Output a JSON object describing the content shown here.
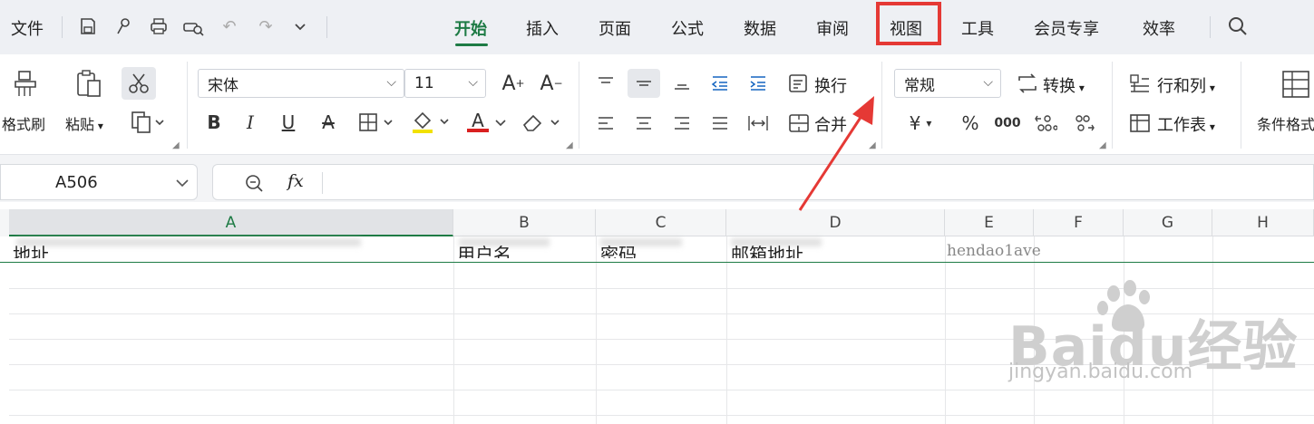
{
  "menu": {
    "file": "文件"
  },
  "tabs": [
    {
      "label": "开始",
      "active": true
    },
    {
      "label": "插入"
    },
    {
      "label": "页面"
    },
    {
      "label": "公式"
    },
    {
      "label": "数据"
    },
    {
      "label": "审阅"
    },
    {
      "label": "视图",
      "highlighted": true
    },
    {
      "label": "工具"
    },
    {
      "label": "会员专享"
    },
    {
      "label": "效率"
    }
  ],
  "ribbon": {
    "format_painter": "格式刷",
    "paste": "粘贴",
    "font_name": "宋体",
    "font_size": "11",
    "wrap_text": "换行",
    "merge": "合并",
    "number_format": "常规",
    "convert": "转换",
    "rows_cols": "行和列",
    "worksheet": "工作表",
    "conditional_format": "条件格式",
    "currency_symbol": "¥",
    "percent_symbol": "%",
    "thousands_symbol": "000",
    "bold": "B",
    "italic": "I",
    "underline": "U",
    "strike": "A",
    "font_color": "A"
  },
  "formula_bar": {
    "cell_ref": "A506",
    "fx": "fx"
  },
  "columns": [
    "A",
    "B",
    "C",
    "D",
    "E",
    "F",
    "G",
    "H"
  ],
  "row1": {
    "a": "地址",
    "b": "用户名",
    "c": "密码",
    "d": "邮箱地址",
    "e": "hendao1ave"
  },
  "watermark": {
    "brand": "Baidu经验",
    "url": "jingyan.baidu.com"
  },
  "colors": {
    "accent": "#1e7b45",
    "highlight": "#e53935"
  }
}
